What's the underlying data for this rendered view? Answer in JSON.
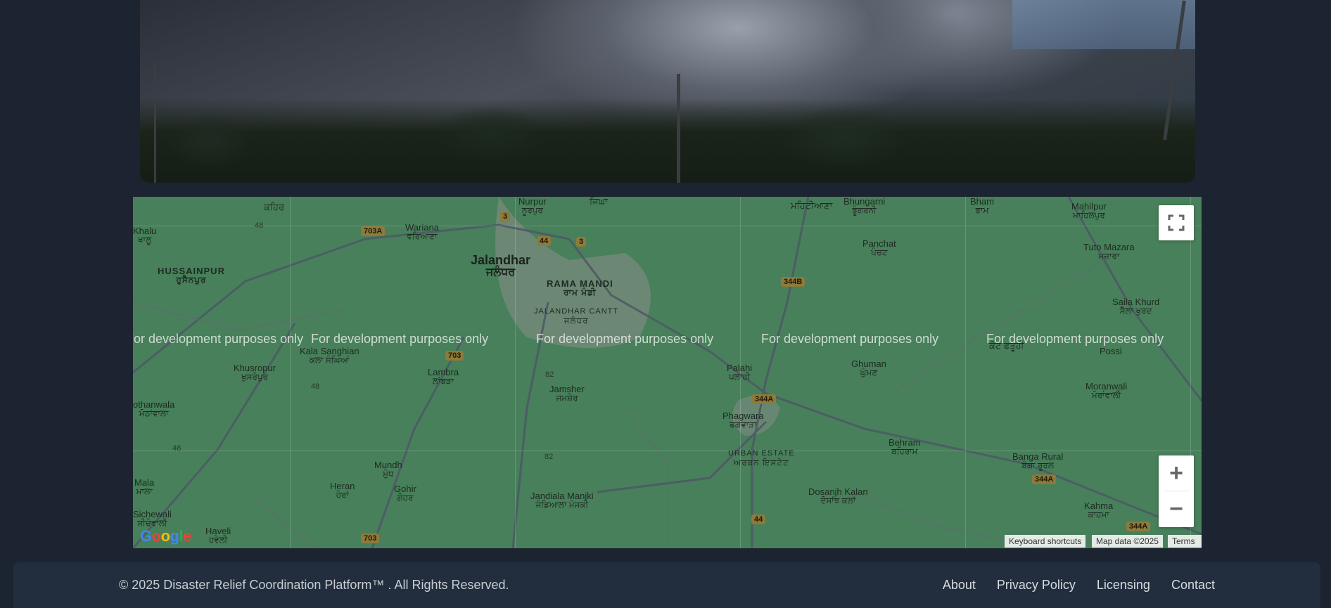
{
  "map": {
    "watermark": "For development purposes only",
    "places": [
      {
        "id": "kahma-top",
        "name": "ਕਹਿਰ",
        "sub": ""
      },
      {
        "id": "khalu",
        "name": "Khalu",
        "sub": "ਖਾਲੂ"
      },
      {
        "id": "hussainpur",
        "name": "HUSSAINPUR",
        "sub": "ਹੁਸੈਨਪੁਰ"
      },
      {
        "id": "wariana",
        "name": "Wariana",
        "sub": "ਵਰਿਆਣਾ"
      },
      {
        "id": "nurpur",
        "name": "Nurpur",
        "sub": "ਨੂਰਪੁਰ"
      },
      {
        "id": "jalandhar",
        "name": "Jalandhar",
        "sub": "ਜਲੰਧਰ"
      },
      {
        "id": "rama-mandi",
        "name": "RAMA MANDI",
        "sub": "ਰਾਮ ਮੰਡੀ"
      },
      {
        "id": "jalandhar-cantt",
        "name": "JALANDHAR CANTT",
        "sub": "ਜਲੰਧਰ"
      },
      {
        "id": "kala-sanghian",
        "name": "Kala Sanghian",
        "sub": "ਕਲਾ ਸੰਘਿਆਂ"
      },
      {
        "id": "khusropur",
        "name": "Khusropur",
        "sub": "ਖੁਸਰੋਪੁਰ"
      },
      {
        "id": "lambra",
        "name": "Lambra",
        "sub": "ਲਾਂਬੜਾ"
      },
      {
        "id": "jamsher",
        "name": "Jamsher",
        "sub": "ਜਮਸ਼ੇਰ"
      },
      {
        "id": "bhungarni",
        "name": "Bhungarni",
        "sub": "ਭੂੰਗਰਨੀ"
      },
      {
        "id": "panchat",
        "name": "Panchat",
        "sub": "ਪੰਚਟ"
      },
      {
        "id": "bham",
        "name": "Bham",
        "sub": "ਭਾਮ"
      },
      {
        "id": "mahilpur",
        "name": "Mahilpur",
        "sub": "ਮਾਹਿਲਪੁਰ"
      },
      {
        "id": "tuto-mazara",
        "name": "Tuto Mazara",
        "sub": "ਮਜ਼ਾਰਾ"
      },
      {
        "id": "saila-khurd",
        "name": "Saila Khurd",
        "sub": "ਸੈਲਾ ਖੁਰਦ"
      },
      {
        "id": "possi",
        "name": "Possi",
        "sub": ""
      },
      {
        "id": "kot-fatuhi",
        "name": "ਕੋਟ ਫਤੂਹੀ",
        "sub": ""
      },
      {
        "id": "palahi",
        "name": "Palahi",
        "sub": "ਪਲਾਹੀ"
      },
      {
        "id": "ghuman",
        "name": "Ghuman",
        "sub": "ਘੁੰਮਣ"
      },
      {
        "id": "moranwali",
        "name": "Moranwali",
        "sub": "ਮੋਰਾਂਵਾਲੀ"
      },
      {
        "id": "phagwara",
        "name": "Phagwara",
        "sub": "ਫਗਵਾੜਾ"
      },
      {
        "id": "urban-estate",
        "name": "URBAN ESTATE",
        "sub": "ਅਰਬਨ ਇਸਟੇਟ"
      },
      {
        "id": "behram",
        "name": "Behram",
        "sub": "ਬਹਿਰਾਮ"
      },
      {
        "id": "banga-rural",
        "name": "Banga Rural",
        "sub": "ਬੰਗਾ ਰੂਰਲ"
      },
      {
        "id": "kahma",
        "name": "Kahma",
        "sub": "ਕਾਹਮਾ"
      },
      {
        "id": "dosanjh-kalan",
        "name": "Dosanjh Kalan",
        "sub": "ਦੋਸਾਂਝ ਕਲਾਂ"
      },
      {
        "id": "jandiala-manjki",
        "name": "Jandiala Manjki",
        "sub": "ਜੰਡਿਆਲਾ ਮੰਜਕੀ"
      },
      {
        "id": "gohir",
        "name": "Gohir",
        "sub": "ਗੋਹਰ"
      },
      {
        "id": "heran",
        "name": "Heran",
        "sub": "ਹੇਰਾਂ"
      },
      {
        "id": "mundh",
        "name": "Mundh",
        "sub": "ਮੁੰਧ"
      },
      {
        "id": "mala",
        "name": "Mala",
        "sub": "ਮਾਲਾ"
      },
      {
        "id": "sichewali",
        "name": "Sichewali",
        "sub": "ਸੀਚੇਵਾਲੀ"
      },
      {
        "id": "haveli",
        "name": "Haveli",
        "sub": "ਹਵੇਲੀ"
      },
      {
        "id": "othanwala",
        "name": "othanwala",
        "sub": "ਮੋਠਾਂਵਾਲਾ"
      },
      {
        "id": "mehtianwala",
        "name": "ਮਹਿਟੀਆਣਾ",
        "sub": ""
      },
      {
        "id": "jhigha",
        "name": "ਜਿਘਾ",
        "sub": ""
      }
    ],
    "shields": [
      "703A",
      "3",
      "44",
      "3",
      "344B",
      "703",
      "344A",
      "82",
      "82",
      "44",
      "703",
      "344A",
      "344A",
      "48",
      "48",
      "48"
    ],
    "attribution": {
      "keyboard": "Keyboard shortcuts",
      "data": "Map data ©2025",
      "terms": "Terms"
    },
    "google_logo": "Google",
    "zoom_in": "+",
    "zoom_out": "−"
  },
  "footer": {
    "copyright": "© 2025 Disaster Relief Coordination Platform™ . All Rights Reserved.",
    "links": [
      "About",
      "Privacy Policy",
      "Licensing",
      "Contact"
    ]
  },
  "colors": {
    "page_bg": "#1b2430",
    "footer_bg": "#222d3d",
    "map_green": "#47805a"
  }
}
